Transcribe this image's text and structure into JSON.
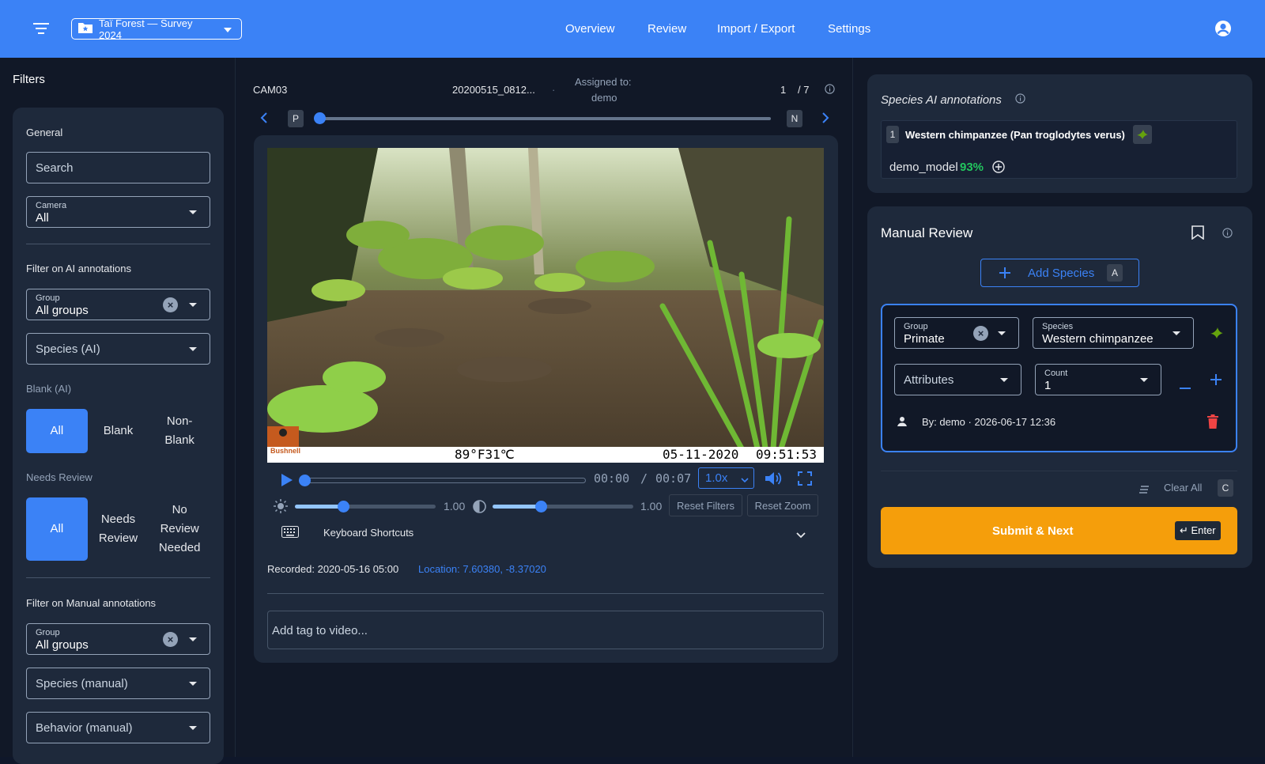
{
  "header": {
    "project_label": "Taï Forest — Survey 2024",
    "nav": [
      "Overview",
      "Review",
      "Import / Export",
      "Settings"
    ]
  },
  "filters": {
    "title": "Filters",
    "general_label": "General",
    "search_placeholder": "Search",
    "camera": {
      "label": "Camera",
      "value": "All"
    },
    "ai_section_label": "Filter on AI annotations",
    "ai_group": {
      "label": "Group",
      "value": "All groups"
    },
    "ai_species_placeholder": "Species (AI)",
    "blank_label": "Blank (AI)",
    "blank_options": [
      "All",
      "Blank",
      "Non-\nBlank"
    ],
    "needs_review_label": "Needs Review",
    "review_options": [
      "All",
      "Needs\nReview",
      "No\nReview\nNeeded"
    ],
    "manual_section_label": "Filter on Manual annotations",
    "manual_group": {
      "label": "Group",
      "value": "All groups"
    },
    "manual_species_placeholder": "Species (manual)",
    "manual_behavior_placeholder": "Behavior (manual)"
  },
  "media": {
    "camera": "CAM03",
    "filename": "20200515_0812...",
    "separator": "·",
    "assigned_label": "Assigned to:",
    "assigned_user": "demo",
    "index": "1",
    "total": "/ 7",
    "prev_key": "P",
    "next_key": "N",
    "overlay": {
      "temp": "89°F31℃",
      "date": "05-11-2020",
      "time": "09:51:53",
      "brand": "Bushnell"
    },
    "time_current": "00:00",
    "time_sep": "/",
    "time_total": "00:07",
    "speed": "1.0x",
    "brightness": "1.00",
    "contrast": "1.00",
    "reset_filters": "Reset Filters",
    "reset_zoom": "Reset Zoom",
    "shortcuts_label": "Keyboard Shortcuts",
    "recorded": "Recorded: 2020-05-16 05:00",
    "location": "Location: 7.60380, -8.37020",
    "tag_placeholder": "Add tag to video...",
    "progress": 0
  },
  "ai_annotations": {
    "title": "Species AI annotations",
    "item_index": "1",
    "species": "Western chimpanzee (Pan troglodytes verus)",
    "model": "demo_model",
    "confidence": "93%"
  },
  "manual_review": {
    "title": "Manual Review",
    "add_species_label": "Add Species",
    "add_species_key": "A",
    "group": {
      "label": "Group",
      "value": "Primate"
    },
    "species": {
      "label": "Species",
      "value": "Western chimpanzee"
    },
    "attributes_placeholder": "Attributes",
    "count": {
      "label": "Count",
      "value": "1"
    },
    "by_line": "By: demo · 2026-06-17 12:36",
    "clear_all": "Clear All",
    "clear_key": "C",
    "submit_label": "Submit & Next",
    "submit_key": "↵ Enter"
  },
  "colors": {
    "primary": "#3b82f6",
    "submit": "#f59e0b",
    "danger": "#ef4444",
    "confidence": "#22c55e",
    "leaf": "#65a30d"
  }
}
